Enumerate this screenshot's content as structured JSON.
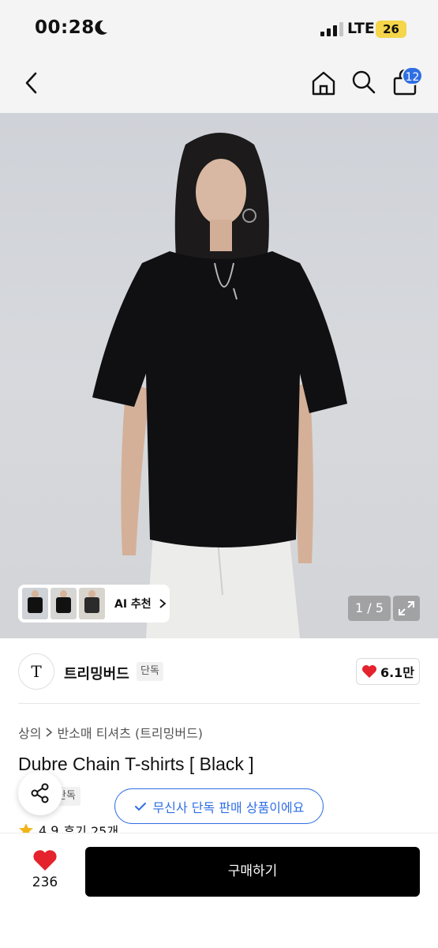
{
  "status_bar": {
    "time": "00:28",
    "network": "LTE",
    "battery": "26"
  },
  "nav": {
    "cart_count": "12"
  },
  "hero": {
    "page_counter": "1 / 5",
    "ai_recommend_label": "AI 추천"
  },
  "brand": {
    "logo_text": "T",
    "name": "트리밍버드",
    "exclusive_tag": "단독",
    "likes": "6.1만"
  },
  "breadcrumb": {
    "category": "상의",
    "subcategory": "반소매 티셔츠 (트리밍버드)"
  },
  "product": {
    "title": "Dubre Chain T-shirts [ Black ]",
    "exclusive_tag": "단독",
    "musinsa_banner": "무신사 단독 판매 상품이에요",
    "rating": "4.9",
    "reviews": "후기 25개"
  },
  "bottom_bar": {
    "wish_count": "236",
    "buy_label": "구매하기"
  },
  "colors": {
    "accent_blue": "#2f6fe4",
    "heart_red": "#e4232d",
    "buy_black": "#000000"
  }
}
